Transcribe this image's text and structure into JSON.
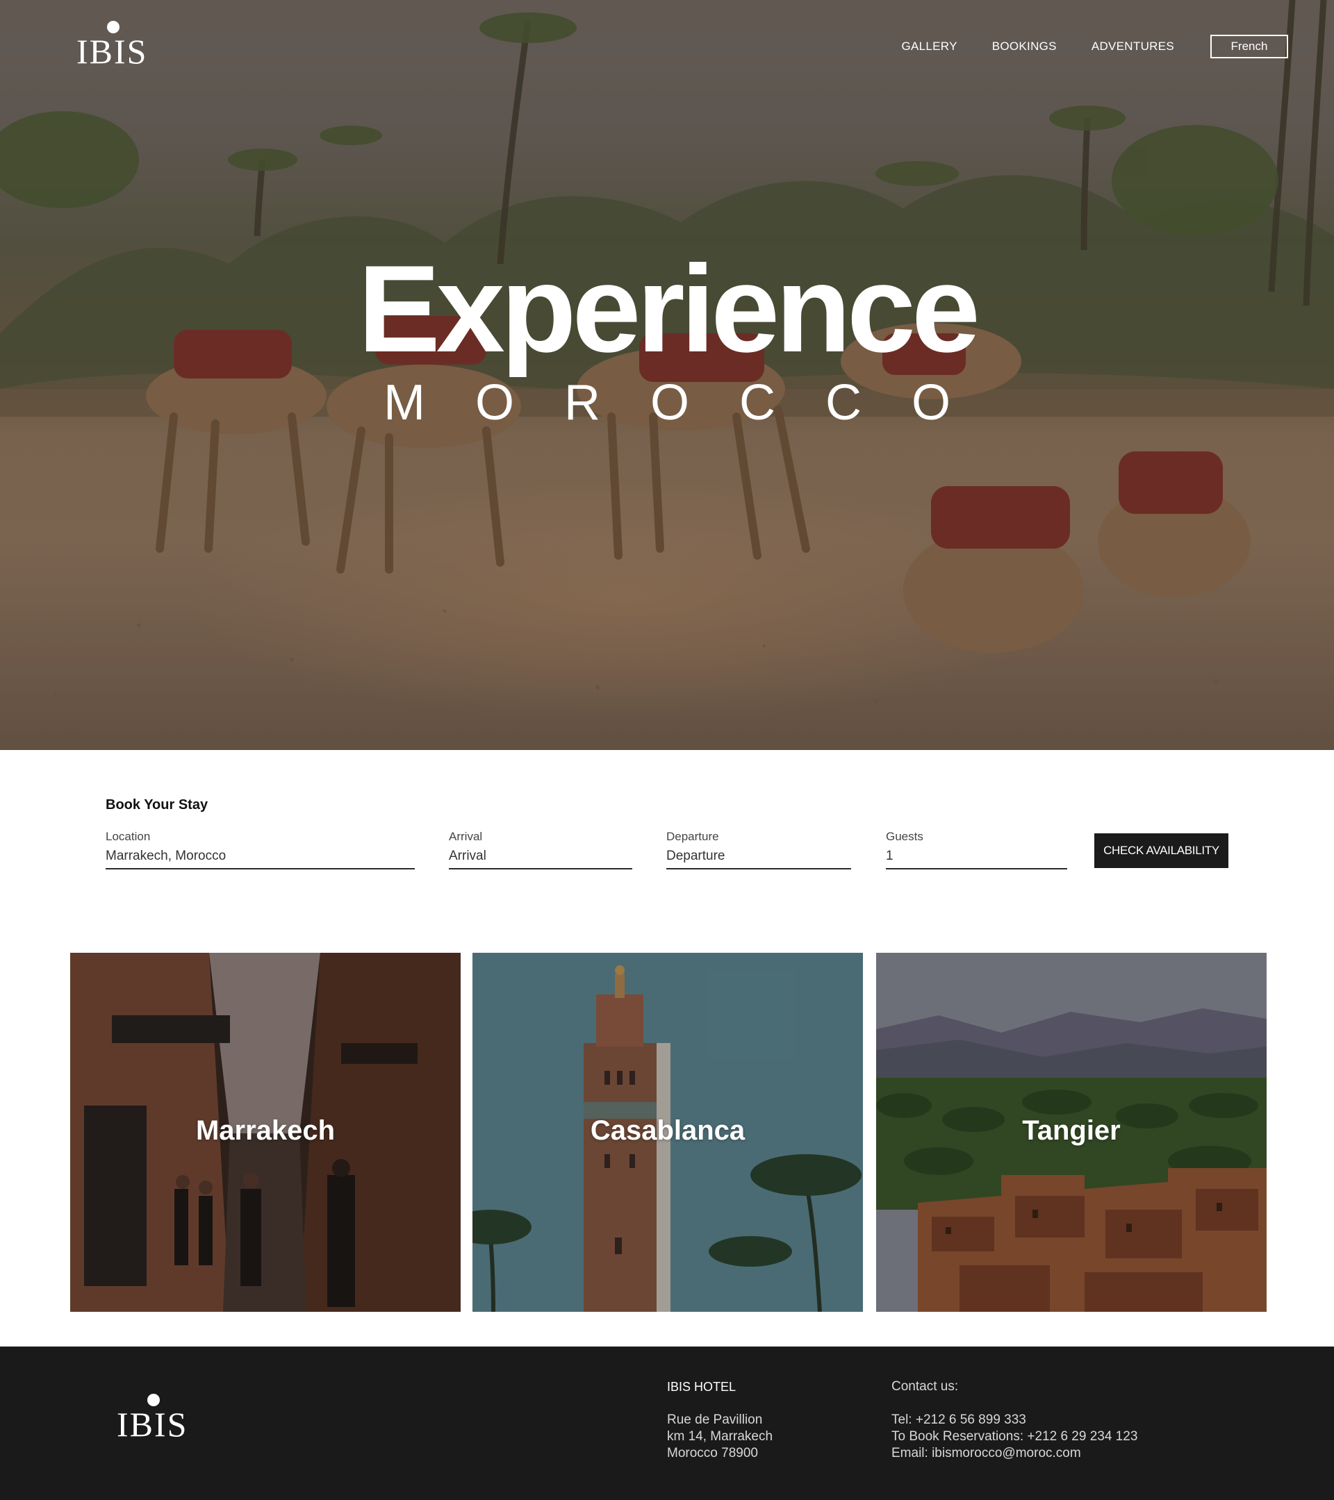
{
  "brand": {
    "logo_text": "IBIS"
  },
  "nav": {
    "links": [
      "GALLERY",
      "BOOKINGS",
      "ADVENTURES"
    ],
    "language_button": "French"
  },
  "hero": {
    "title": "Experience",
    "subtitle": "MOROCCO"
  },
  "booking": {
    "heading": "Book Your Stay",
    "location": {
      "label": "Location",
      "value": "Marrakech, Morocco"
    },
    "arrival": {
      "label": "Arrival",
      "placeholder": "Arrival"
    },
    "departure": {
      "label": "Departure",
      "placeholder": "Departure"
    },
    "guests": {
      "label": "Guests",
      "value": "1"
    },
    "button": "CHECK AVAILABILITY"
  },
  "cities": [
    {
      "name": "Marrakech"
    },
    {
      "name": "Casablanca"
    },
    {
      "name": "Tangier"
    }
  ],
  "footer": {
    "hotel": {
      "title": "IBIS HOTEL",
      "address": [
        "Rue de Pavillion",
        "km 14, Marrakech",
        "Morocco 78900"
      ]
    },
    "contact": {
      "title": "Contact us:",
      "lines": [
        "Tel: +212 6 56 899 333",
        "To Book Reservations: +212 6 29 234 123",
        "Email: ibismorocco@moroc.com"
      ]
    }
  },
  "colors": {
    "footer_bg": "#1a1a1a",
    "button_bg": "#1b1b1b",
    "hero_sand": "#8d735c"
  }
}
